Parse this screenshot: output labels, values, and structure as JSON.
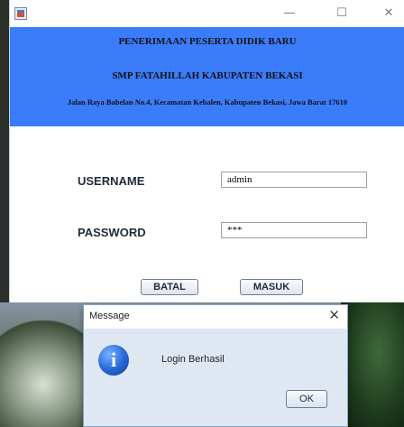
{
  "window": {
    "controls": {
      "minimize": "—",
      "maximize": "☐",
      "close": "✕"
    }
  },
  "banner": {
    "line1": "PENERIMAAN PESERTA DIDIK BARU",
    "line2": "SMP FATAHILLAH KABUPATEN BEKASI",
    "line3": "Jalan Raya Babelan No.4, Kecamatan Kebalen, Kabupaten Bekasi, Jawa Barat 17610",
    "color": "#3b7cfb"
  },
  "form": {
    "username_label": "USERNAME",
    "username_value": "admin",
    "password_label": "PASSWORD",
    "password_value": "***",
    "cancel_label": "BATAL",
    "login_label": "MASUK"
  },
  "dialog": {
    "title": "Message",
    "close": "✕",
    "icon": "info-icon",
    "icon_glyph": "i",
    "message": "Login Berhasil",
    "ok_label": "OK"
  }
}
